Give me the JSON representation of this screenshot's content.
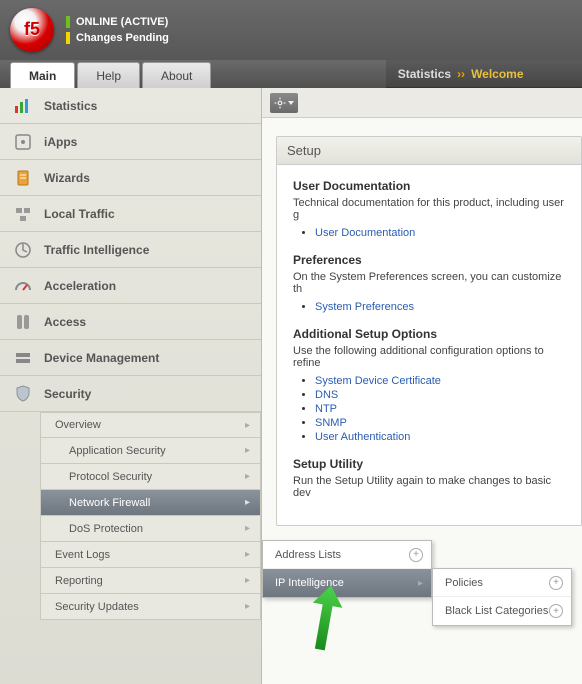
{
  "status": {
    "line1": "ONLINE (ACTIVE)",
    "line2": "Changes Pending"
  },
  "tabs": {
    "main": "Main",
    "help": "Help",
    "about": "About"
  },
  "breadcrumb": {
    "root": "Statistics",
    "sep": "››",
    "current": "Welcome"
  },
  "nav": {
    "statistics": "Statistics",
    "iapps": "iApps",
    "wizards": "Wizards",
    "local_traffic": "Local Traffic",
    "traffic_intel": "Traffic Intelligence",
    "acceleration": "Acceleration",
    "access": "Access",
    "device_mgmt": "Device Management",
    "security": "Security"
  },
  "security_sub": {
    "overview": "Overview",
    "app_sec": "Application Security",
    "proto_sec": "Protocol Security",
    "net_fw": "Network Firewall",
    "dos": "DoS Protection",
    "event_logs": "Event Logs",
    "reporting": "Reporting",
    "sec_updates": "Security Updates"
  },
  "flyout1": {
    "addr_lists": "Address Lists",
    "ip_intel": "IP Intelligence"
  },
  "flyout2": {
    "policies": "Policies",
    "blacklist": "Black List Categories"
  },
  "panel": {
    "title": "Setup",
    "h_userdoc": "User Documentation",
    "p_userdoc": "Technical documentation for this product, including user g",
    "link_userdoc": "User Documentation",
    "h_prefs": "Preferences",
    "p_prefs": "On the System Preferences screen, you can customize th",
    "link_prefs": "System Preferences",
    "h_addl": "Additional Setup Options",
    "p_addl": "Use the following additional configuration options to refine",
    "link_cert": "System Device Certificate",
    "link_dns": "DNS",
    "link_ntp": "NTP",
    "link_snmp": "SNMP",
    "link_userauth": "User Authentication",
    "h_util": "Setup Utility",
    "p_util": "Run the Setup Utility again to make changes to basic dev"
  }
}
